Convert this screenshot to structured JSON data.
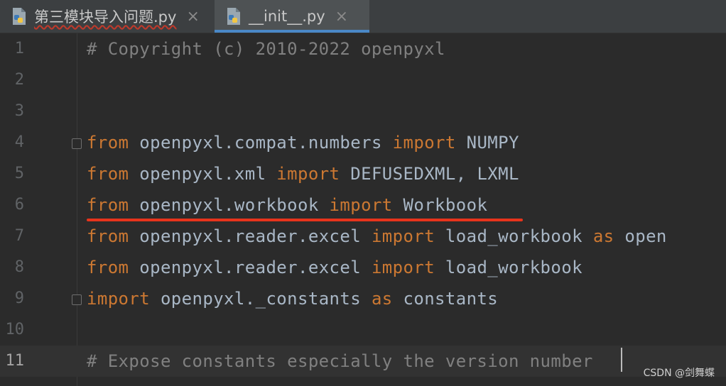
{
  "tabs": [
    {
      "label": "第三模块导入问题.py",
      "icon": "python-file-icon",
      "close": "×"
    },
    {
      "label": "__init__.py",
      "icon": "python-file-icon",
      "close": "×",
      "active": true
    }
  ],
  "editor": {
    "lines": [
      {
        "n": "1",
        "tokens": [
          {
            "t": "# Copyright (c) 2010-2022 openpyxl",
            "c": "cm"
          }
        ]
      },
      {
        "n": "2",
        "tokens": []
      },
      {
        "n": "3",
        "tokens": []
      },
      {
        "n": "4",
        "tokens": [
          {
            "t": "from",
            "c": "kw"
          },
          {
            "t": " openpyxl.compat.numbers ",
            "c": ""
          },
          {
            "t": "import",
            "c": "kw"
          },
          {
            "t": " NUMPY",
            "c": ""
          }
        ]
      },
      {
        "n": "5",
        "tokens": [
          {
            "t": "from",
            "c": "kw"
          },
          {
            "t": " openpyxl.xml ",
            "c": ""
          },
          {
            "t": "import",
            "c": "kw"
          },
          {
            "t": " DEFUSEDXML, LXML",
            "c": ""
          }
        ]
      },
      {
        "n": "6",
        "tokens": [
          {
            "t": "from",
            "c": "kw"
          },
          {
            "t": " openpyxl.workbook ",
            "c": ""
          },
          {
            "t": "import",
            "c": "kw"
          },
          {
            "t": " Workbook",
            "c": ""
          }
        ]
      },
      {
        "n": "7",
        "tokens": [
          {
            "t": "from",
            "c": "kw"
          },
          {
            "t": " openpyxl.reader.excel ",
            "c": ""
          },
          {
            "t": "import",
            "c": "kw"
          },
          {
            "t": " load_workbook ",
            "c": ""
          },
          {
            "t": "as",
            "c": "kw"
          },
          {
            "t": " open",
            "c": ""
          }
        ]
      },
      {
        "n": "8",
        "tokens": [
          {
            "t": "from",
            "c": "kw"
          },
          {
            "t": " openpyxl.reader.excel ",
            "c": ""
          },
          {
            "t": "import",
            "c": "kw"
          },
          {
            "t": " load_workbook",
            "c": ""
          }
        ]
      },
      {
        "n": "9",
        "tokens": [
          {
            "t": "import",
            "c": "kw"
          },
          {
            "t": " openpyxl._constants ",
            "c": ""
          },
          {
            "t": "as",
            "c": "kw"
          },
          {
            "t": " constants",
            "c": ""
          }
        ]
      },
      {
        "n": "10",
        "tokens": []
      },
      {
        "n": "11",
        "tokens": [
          {
            "t": "# Expose constants especially the version number",
            "c": "cm"
          }
        ],
        "current": true
      }
    ]
  },
  "watermark": "CSDN @剑舞蝶",
  "colors": {
    "keyword": "#cc7832",
    "comment": "#808080",
    "text": "#a9b7c6",
    "annotation": "#e8341c",
    "tab_accent": "#4a88c7"
  }
}
